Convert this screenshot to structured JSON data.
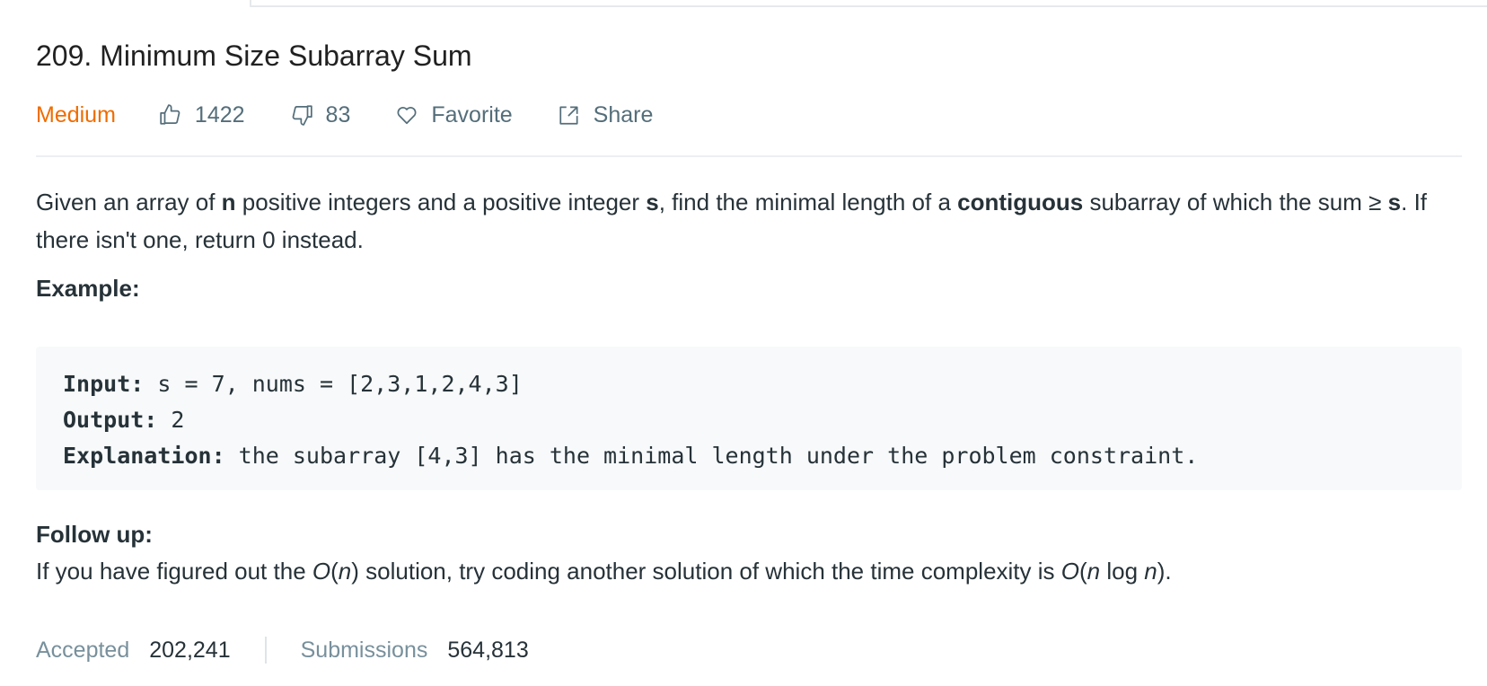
{
  "problem": {
    "title": "209. Minimum Size Subarray Sum",
    "difficulty": "Medium",
    "likes": "1422",
    "dislikes": "83",
    "favorite_label": "Favorite",
    "share_label": "Share"
  },
  "description": {
    "p1_a": "Given an array of ",
    "p1_n": "n",
    "p1_b": " positive integers and a positive integer ",
    "p1_s": "s",
    "p1_c": ", find the minimal length of a ",
    "p1_contiguous": "contiguous",
    "p1_d": " subarray of which the sum ≥ ",
    "p1_s2": "s",
    "p1_e": ". If there isn't one, return 0 instead."
  },
  "example": {
    "heading": "Example:",
    "input_label": "Input:",
    "input_value": " s = 7, nums = [2,3,1,2,4,3]",
    "output_label": "Output:",
    "output_value": " 2",
    "explanation_label": "Explanation:",
    "explanation_value": " the subarray [4,3] has the minimal length under the problem constraint."
  },
  "followup": {
    "heading": "Follow up:",
    "t1": "If you have figured out the ",
    "o1": "O",
    "p1": "(",
    "n1": "n",
    "p2": ")",
    "t2": " solution, try coding another solution of which the time complexity is ",
    "o2": "O",
    "p3": "(",
    "n2": "n",
    "t3": " log ",
    "n3": "n",
    "p4": ")."
  },
  "stats": {
    "accepted_label": "Accepted",
    "accepted_value": "202,241",
    "submissions_label": "Submissions",
    "submissions_value": "564,813"
  },
  "colors": {
    "difficulty": "#ef6c00",
    "text": "#263238",
    "muted": "#546e7a",
    "code_bg": "#f7f9fa"
  },
  "icons": [
    "thumbs-up-icon",
    "thumbs-down-icon",
    "heart-icon",
    "share-icon"
  ]
}
